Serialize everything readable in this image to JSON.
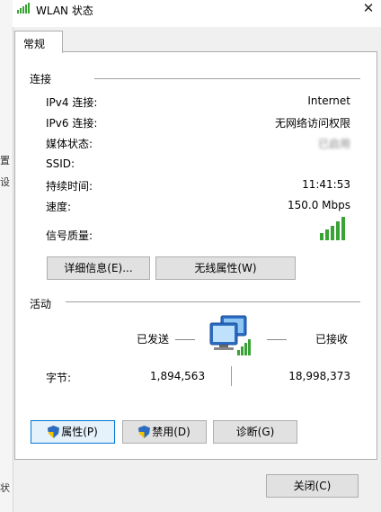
{
  "window": {
    "title": "WLAN 状态",
    "close_glyph": "✕"
  },
  "tabs": [
    {
      "label": "常规"
    }
  ],
  "connection": {
    "header": "连接",
    "rows": [
      {
        "label": "IPv4 连接:",
        "value": "Internet"
      },
      {
        "label": "IPv6 连接:",
        "value": "无网络访问权限"
      },
      {
        "label": "媒体状态:",
        "value": "已启用"
      },
      {
        "label": "SSID:",
        "value": ""
      },
      {
        "label": "持续时间:",
        "value": "11:41:53"
      },
      {
        "label": "速度:",
        "value": "150.0 Mbps"
      },
      {
        "label": "信号质量:",
        "value": ""
      }
    ],
    "signal_bars_filled": 5,
    "signal_bars_total": 5,
    "details_button": "详细信息(E)...",
    "wireless_props_button": "无线属性(W)"
  },
  "activity": {
    "header": "活动",
    "sent_label": "已发送",
    "received_label": "已接收",
    "bytes_label": "字节:",
    "bytes_sent": "1,894,563",
    "bytes_received": "18,998,373"
  },
  "buttons": {
    "properties": "属性(P)",
    "disable": "禁用(D)",
    "diagnose": "诊断(G)",
    "close": "关闭(C)"
  },
  "left_fragments": [
    "置",
    "设",
    "状"
  ],
  "colors": {
    "signal_green": "#3aa336",
    "accent_blue": "#0078d7"
  }
}
